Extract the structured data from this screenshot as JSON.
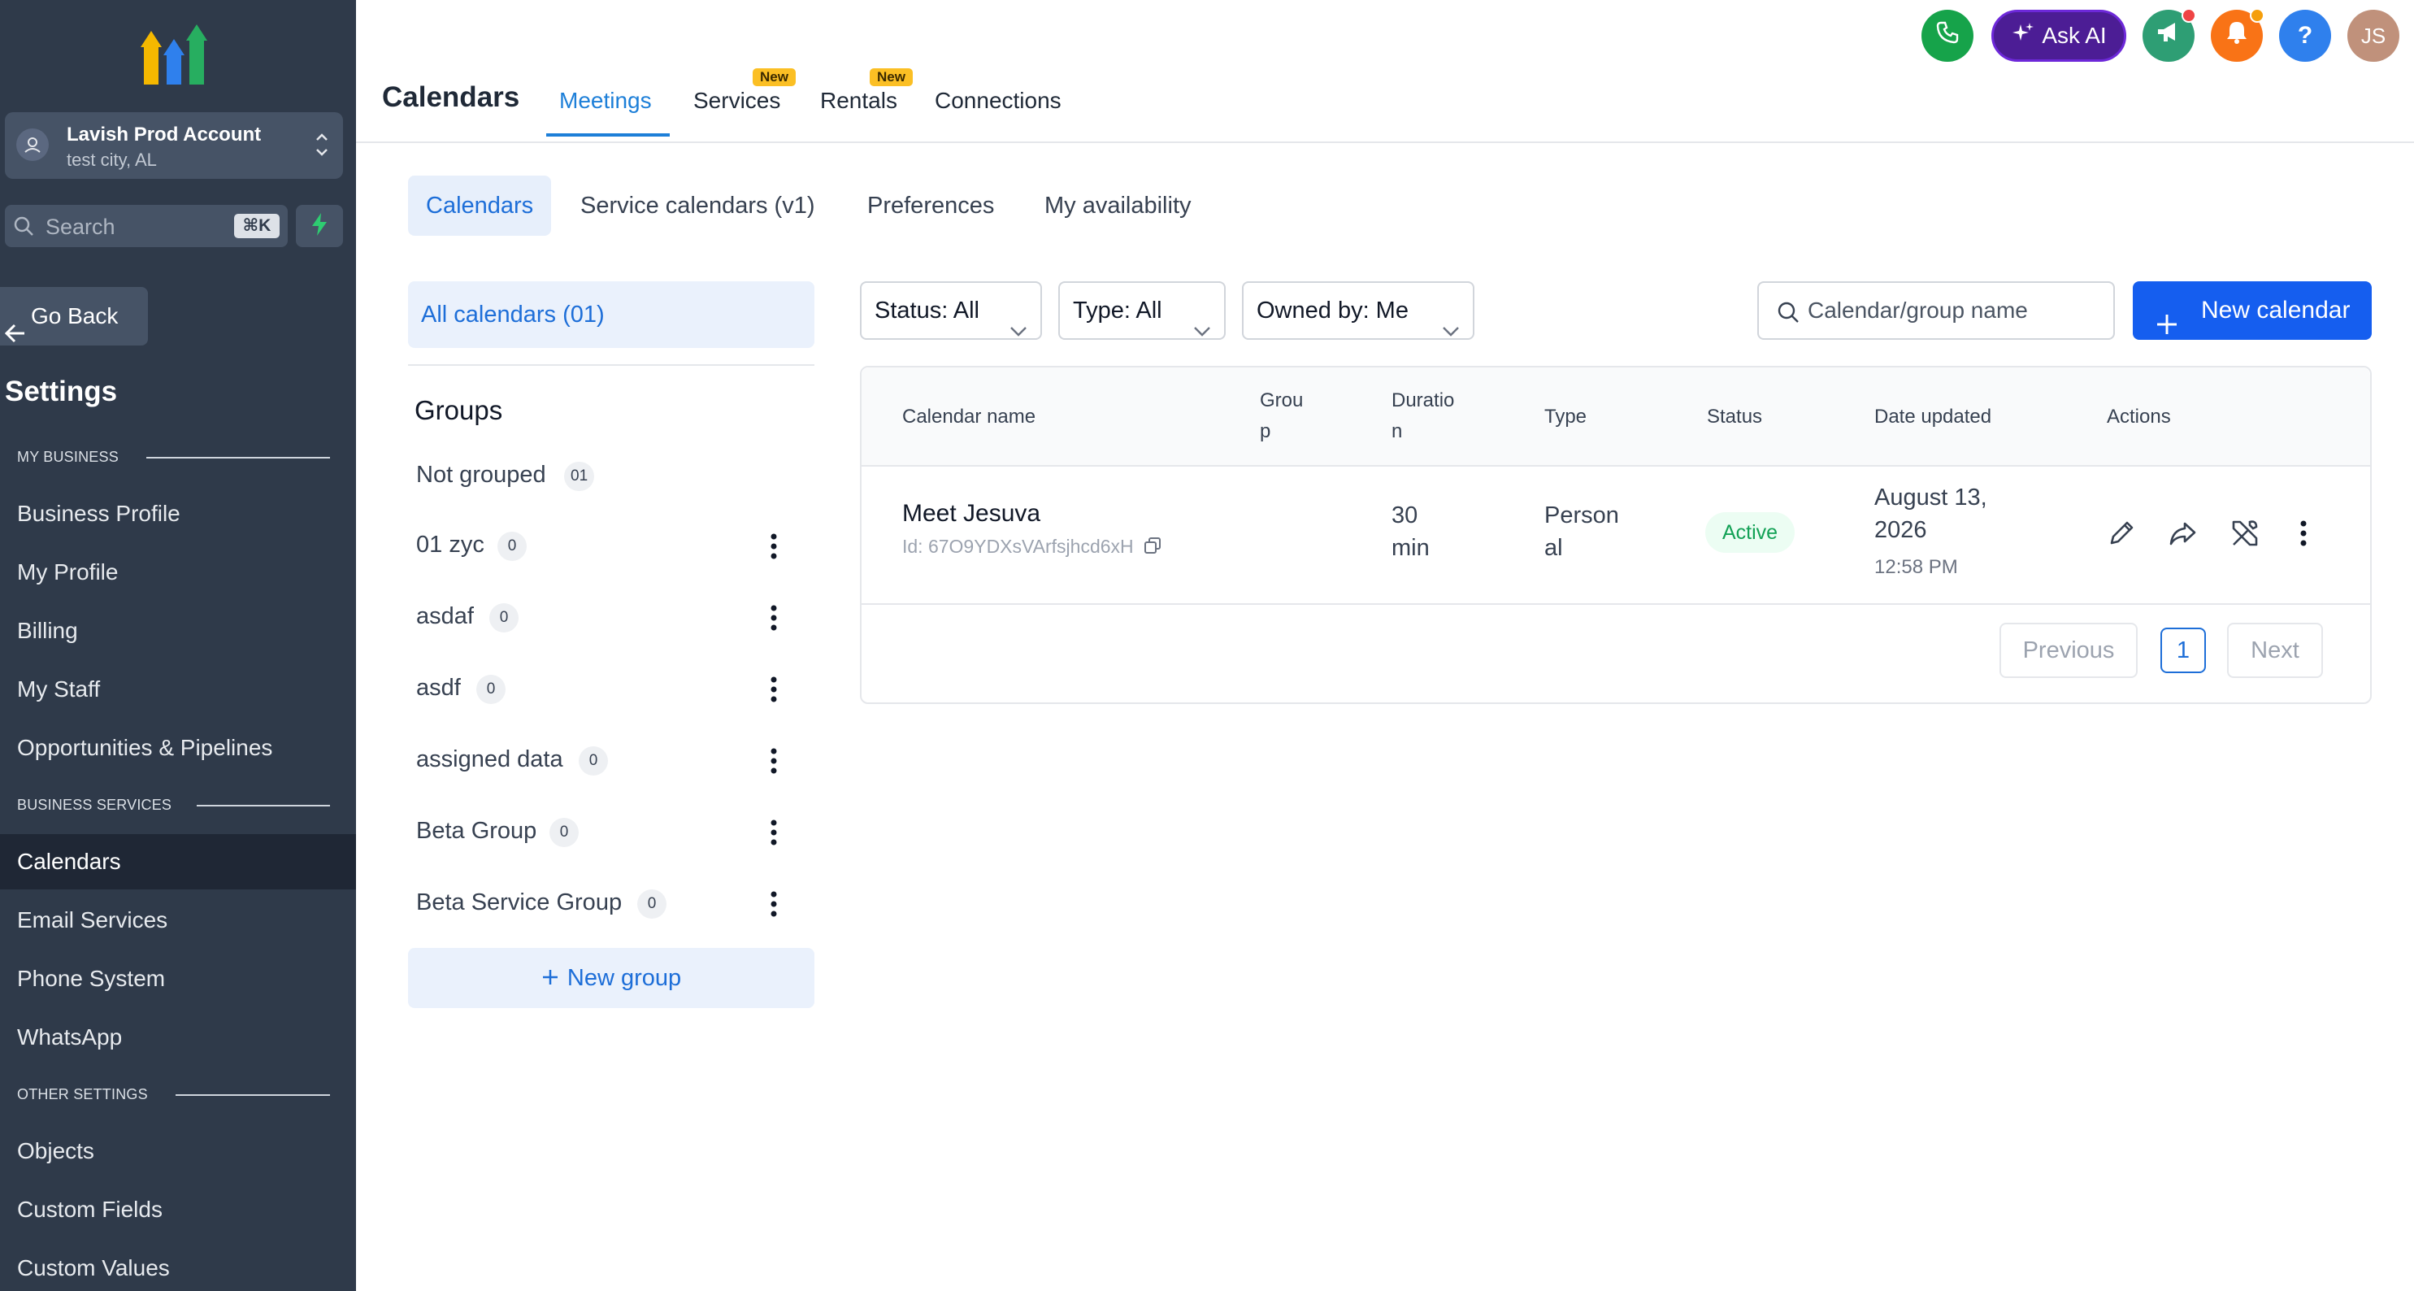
{
  "sidebar": {
    "account": {
      "name": "Lavish Prod Account",
      "location": "test city, AL"
    },
    "search": {
      "placeholder": "Search",
      "shortcut": "⌘K"
    },
    "go_back": "Go Back",
    "title": "Settings",
    "sections": [
      {
        "heading": "MY BUSINESS",
        "items": [
          "Business Profile",
          "My Profile",
          "Billing",
          "My Staff",
          "Opportunities & Pipelines"
        ]
      },
      {
        "heading": "BUSINESS SERVICES",
        "items": [
          "Calendars",
          "Email Services",
          "Phone System",
          "WhatsApp"
        ]
      },
      {
        "heading": "OTHER SETTINGS",
        "items": [
          "Objects",
          "Custom Fields",
          "Custom Values"
        ]
      }
    ],
    "active_item": "Calendars"
  },
  "header": {
    "title": "Calendars",
    "tabs": [
      {
        "label": "Meetings",
        "badge": "",
        "active": true
      },
      {
        "label": "Services",
        "badge": "New",
        "active": false
      },
      {
        "label": "Rentals",
        "badge": "New",
        "active": false
      },
      {
        "label": "Connections",
        "badge": "",
        "active": false
      }
    ],
    "ask_ai": "Ask AI",
    "help": "?",
    "avatar_initials": "JS"
  },
  "subtabs": [
    {
      "label": "Calendars",
      "active": true
    },
    {
      "label": "Service calendars (v1)",
      "active": false
    },
    {
      "label": "Preferences",
      "active": false
    },
    {
      "label": "My availability",
      "active": false
    }
  ],
  "left_panel": {
    "all_calendars": "All calendars (01)",
    "groups_title": "Groups",
    "groups": [
      {
        "name": "Not grouped",
        "count": "01",
        "menu": false
      },
      {
        "name": "01 zyc",
        "count": "0",
        "menu": true
      },
      {
        "name": "asdaf",
        "count": "0",
        "menu": true
      },
      {
        "name": "asdf",
        "count": "0",
        "menu": true
      },
      {
        "name": "assigned data",
        "count": "0",
        "menu": true
      },
      {
        "name": "Beta Group",
        "count": "0",
        "menu": true
      },
      {
        "name": "Beta Service Group",
        "count": "0",
        "menu": true
      }
    ],
    "new_group": "New group"
  },
  "filters": {
    "status": "Status: All",
    "type": "Type: All",
    "owned_by": "Owned by: Me",
    "search_placeholder": "Calendar/group name",
    "new_calendar": "New calendar"
  },
  "table": {
    "headers": {
      "name": "Calendar name",
      "group_1": "Grou",
      "group_2": "p",
      "duration_1": "Duratio",
      "duration_2": "n",
      "type": "Type",
      "status": "Status",
      "date_updated": "Date updated",
      "actions": "Actions"
    },
    "rows": [
      {
        "name": "Meet Jesuva",
        "id": "Id: 67O9YDXsVArfsjhcd6xH",
        "duration_1": "30",
        "duration_2": "min",
        "type_1": "Person",
        "type_2": "al",
        "status": "Active",
        "date_1": "August 13,",
        "date_2": "2026",
        "time": "12:58 PM"
      }
    ],
    "pagination": {
      "previous": "Previous",
      "current": "1",
      "next": "Next"
    }
  },
  "colors": {
    "sidebar_bg": "#2f3a4a",
    "primary": "#155eef",
    "tab_active": "#1d7fd8",
    "status_active": "#12a155",
    "badge_new": "#fbbf24"
  }
}
